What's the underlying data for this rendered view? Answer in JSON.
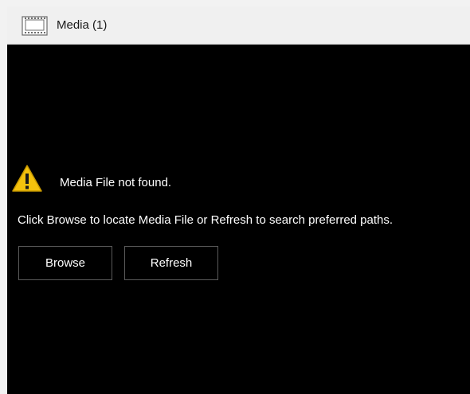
{
  "window": {
    "title": "Media (1)",
    "icon": "film-icon"
  },
  "content": {
    "warning_icon": "warning-icon",
    "message": "Media File not found.",
    "instructions": "Click Browse to locate Media File or Refresh to search preferred paths.",
    "browse_label": "Browse",
    "refresh_label": "Refresh"
  },
  "colors": {
    "background": "#000000",
    "titlebar": "#f0f0f0",
    "button_border": "#5a5a5a",
    "warning": "#f4c20d"
  }
}
